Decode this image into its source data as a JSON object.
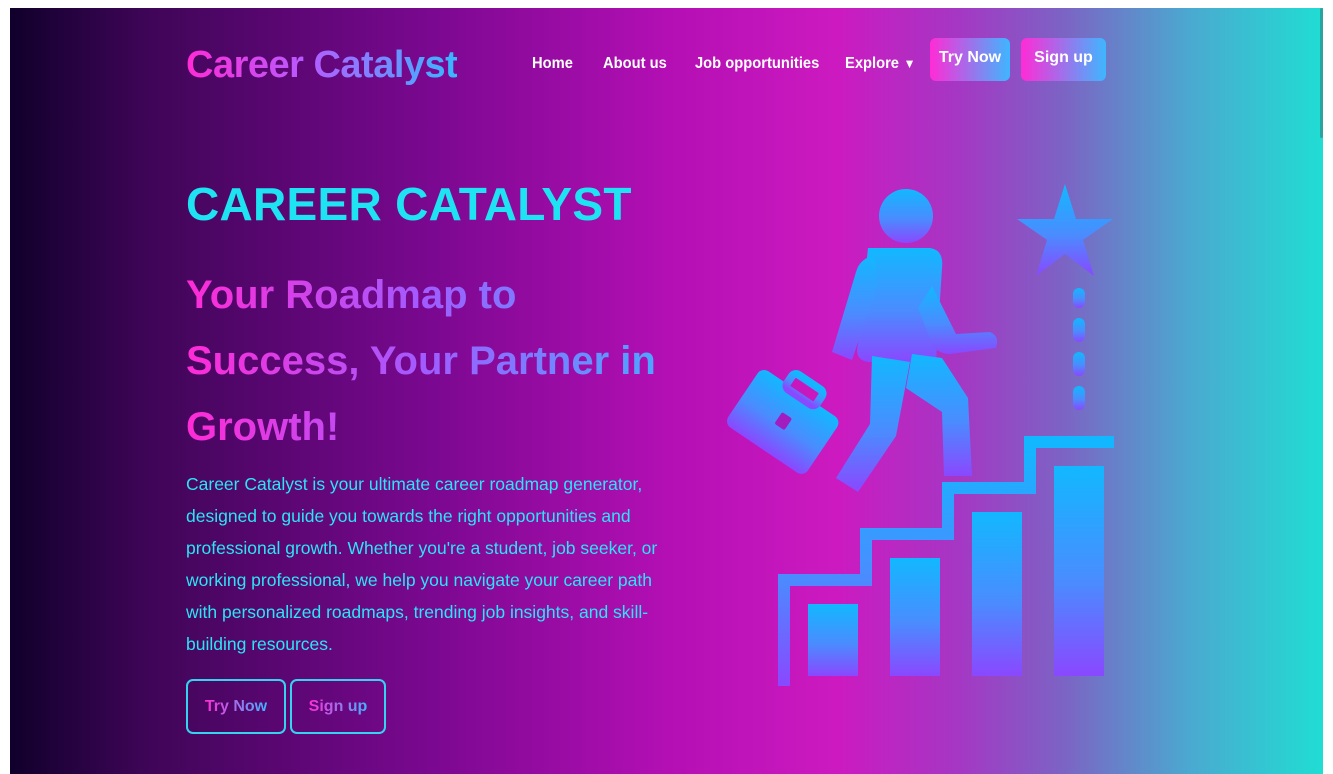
{
  "brand": {
    "logo_text": "Career Catalyst"
  },
  "nav": {
    "home": "Home",
    "about": "About us",
    "jobs": "Job opportunities",
    "explore": "Explore",
    "explore_caret": "▼",
    "try_now": "Try Now",
    "sign_up": "Sign up"
  },
  "hero": {
    "title": "CAREER CATALYST",
    "subtitle": "Your Roadmap to Success, Your Partner in Growth!",
    "description": "Career Catalyst is your ultimate career roadmap generator, designed to guide you towards the right opportunities and professional growth. Whether you're a student, job seeker, or working professional, we help you navigate your career path with personalized roadmaps, trending job insights, and skill-building resources.",
    "try_now": "Try Now",
    "sign_up": "Sign up"
  },
  "illustration": {
    "icon": "career-growth-climbing-stairs-icon"
  },
  "colors": {
    "accent_cyan": "#1ee3f2",
    "accent_pink": "#ff2bd6",
    "accent_blue": "#3fb6ff"
  }
}
